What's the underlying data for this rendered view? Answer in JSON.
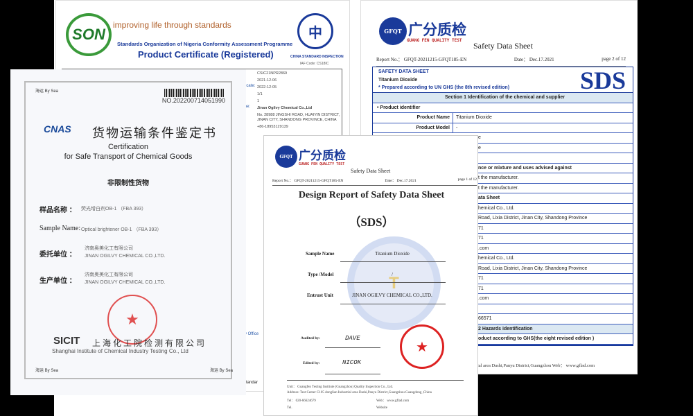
{
  "son": {
    "tagline": "improving life through standards",
    "logo_text": "SON",
    "org": "Standards Organization of Nigeria Conformity Assessment Programme",
    "title": "Product Certificate (Registered)",
    "csi_label": "CHINA STANDARD INSPECTION",
    "iaf": "IAF Code: CS18IC",
    "values": [
      "CSIC21NPR2869",
      "2021-12-06",
      "2022-12-05",
      "1/1",
      "1"
    ],
    "label_cert": "ificate:",
    "label_name": "me:",
    "company": "Jinan Ogilvy Chemical Co.,Ltd",
    "address": "No. 28988 JINGSHI ROAD, HUAIYIN DISTRICT, JINAN CITY, SHANDONG PROVINCE, CHINA",
    "phone": "+86-18953129139",
    "office": "ry Office",
    "standard": "Standar"
  },
  "cnas": {
    "by_sea": "海运 By Sea",
    "no": "NO.202200714051990",
    "logo": "CNAS",
    "title_cn": "货物运输条件鉴定书",
    "title_en1": "Certification",
    "title_en2": "for Safe Transport of Chemical Goods",
    "category": "非限制性货物",
    "sample_cn_label": "样品名称 ：",
    "sample_cn": "荧光增白剂OB-1 （FBA 393）",
    "sample_en_label": "Sample Name:",
    "sample_en": "Optical brightener OB-1 （FBA 393）",
    "client_label": "委托单位 ：",
    "client_cn": "济南奥美化工有限公司",
    "client_en": "JINAN OGILVY CHEMICAL CO.,LTD.",
    "producer_label": "生产单位 ：",
    "producer_cn": "济南奥美化工有限公司",
    "producer_en": "JINAN OGILVY CHEMICAL CO.,LTD.",
    "sicit": "SICIT",
    "sicit_cn": "上海化工院检测有限公司",
    "sicit_en": "Shanghai Institute of Chemical Industry Testing Co., Ltd"
  },
  "gfqt": {
    "logo": "GFQT",
    "cn": "广分质检",
    "en": "GUANG FEN QUALITY TEST"
  },
  "sds2": {
    "title": "Safety Data Sheet",
    "report": "Report No.： GFQT-20211215-GFQT185-EN",
    "date": "Date： Dec.17.2021",
    "page": "page 2 of 12",
    "head_a": "SAFETY DATA SHEET",
    "head_b": "Titanium Dioxide",
    "head_c": "* Prepared according to UN GHS (the 8th revised edition)",
    "sds": "SDS",
    "section1": "Section 1   Identification of the chemical and supplier",
    "identifier": "•   Product identifier",
    "product_name_k": "Product Name",
    "product_name": "Titanium Dioxide",
    "product_model_k": "Product Model",
    "product_model": "-",
    "rows": [
      "e",
      "e",
      "",
      "nce or mixture and uses advised against",
      "t the manufacturer.",
      "t the manufacturer.",
      "ata Sheet",
      "hemical Co., Ltd.",
      " Road, Lixia District, Jinan City, Shandong Province",
      "71",
      "71",
      ".com",
      "hemical Co., Ltd.",
      " Road, Lixia District, Jinan City, Shandong Province",
      "71",
      "71",
      ".com",
      "",
      "66571"
    ],
    "section2": "2    Hazards identification",
    "ghs": "oduct according to GHS(the eight revised edition )",
    "footer": "ian Industrial area Dashi,Panyu District,Guangzhou    Web： www.gflad.com"
  },
  "sds1": {
    "title": "Safety Data Sheet",
    "report": "Report No.： GFQT-20211215-GFQT185-EN",
    "date": "Date： Dec.17.2021",
    "page": "page 1 of 12",
    "big": "Design Report of Safety Data Sheet",
    "sds": "（SDS）",
    "sample_k": "Sample Name",
    "sample": "Titanium Dioxide",
    "type_k": "Type /Model",
    "type": "/",
    "entrust_k": "Entrust Unit",
    "entrust": "JINAN OGILVY CHEMICAL CO.,LTD.",
    "audited_k": "Audited by:",
    "audited": "DAVE",
    "edited_k": "Edited by:",
    "edited": "NICOK",
    "unit": "Unit：  Guangfen Testing Institute (Guangzhou) Quality Inspection Co., Ltd.",
    "address": "Address: Test Center C105 donglian Industrial area Dashi,Panyu District,Guangzhou Guangdong ,China",
    "tel": "Tel：  020-66624679",
    "web": "Web：  www.gflad.com",
    "tel2": "Tel.",
    "website": "Website"
  }
}
